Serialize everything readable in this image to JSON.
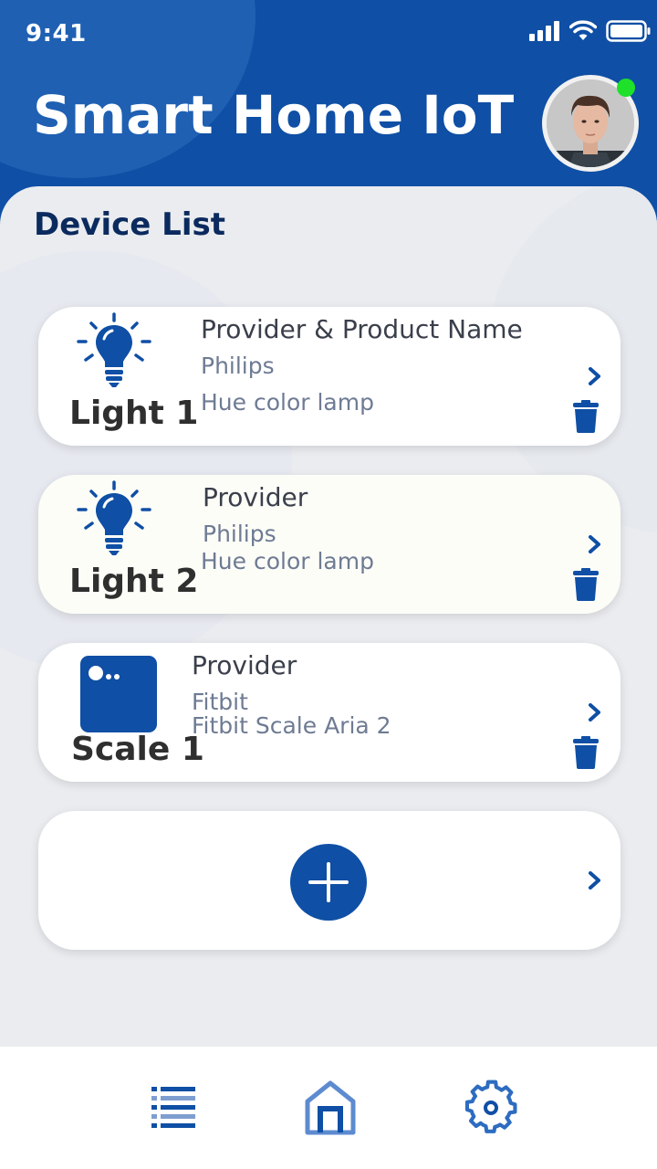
{
  "status_bar": {
    "time": "9:41"
  },
  "header": {
    "title": "Smart Home IoT"
  },
  "main": {
    "section_title": "Device List",
    "devices": [
      {
        "name": "Light 1",
        "heading": "Provider & Product Name",
        "provider": "Philips",
        "product": "Hue color lamp",
        "icon": "bulb-icon"
      },
      {
        "name": "Light 2",
        "heading": "Provider",
        "provider": "Philips",
        "product": "Hue color lamp",
        "icon": "bulb-icon"
      },
      {
        "name": "Scale 1",
        "heading": "Provider",
        "provider": "Fitbit",
        "product": "Fitbit Scale Aria 2",
        "icon": "scale-icon"
      }
    ]
  },
  "nav": {
    "items": [
      "list-icon",
      "home-icon",
      "settings-icon"
    ]
  },
  "colors": {
    "primary": "#0f4fa5",
    "background": "#eaecf0",
    "online": "#1fe12a"
  }
}
